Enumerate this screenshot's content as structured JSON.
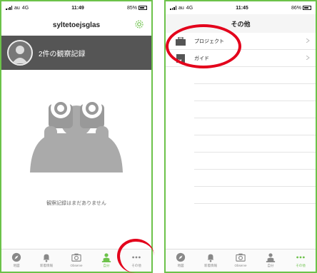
{
  "left_screen": {
    "status": {
      "carrier": "au",
      "network": "4G",
      "time": "11:49",
      "battery_text": "85%"
    },
    "nav_title": "syltetoejsglas",
    "profile": {
      "record_count_label": "2件の観察記録"
    },
    "empty_message": "観察記録はまだありません",
    "tabs": [
      {
        "label": "地図",
        "icon": "compass-icon",
        "active": false
      },
      {
        "label": "新着情報",
        "icon": "bell-icon",
        "active": false
      },
      {
        "label": "Observe",
        "icon": "camera-icon",
        "active": false
      },
      {
        "label": "自分",
        "icon": "person-icon",
        "active": true
      },
      {
        "label": "その他",
        "icon": "more-icon",
        "active": false
      }
    ]
  },
  "right_screen": {
    "status": {
      "carrier": "au",
      "network": "4G",
      "time": "11:45",
      "battery_text": "86%"
    },
    "nav_title": "その他",
    "menu_items": [
      {
        "label": "プロジェクト",
        "icon": "briefcase-icon"
      },
      {
        "label": "ガイド",
        "icon": "book-icon"
      }
    ],
    "tabs": [
      {
        "label": "地図",
        "icon": "compass-icon",
        "active": false
      },
      {
        "label": "新着情報",
        "icon": "bell-icon",
        "active": false
      },
      {
        "label": "Observe",
        "icon": "camera-icon",
        "active": false
      },
      {
        "label": "自分",
        "icon": "person-icon",
        "active": false
      },
      {
        "label": "その他",
        "icon": "more-icon",
        "active": true
      }
    ]
  },
  "colors": {
    "accent": "#6cc24a",
    "annotation": "#e3001b",
    "banner": "#555555"
  }
}
